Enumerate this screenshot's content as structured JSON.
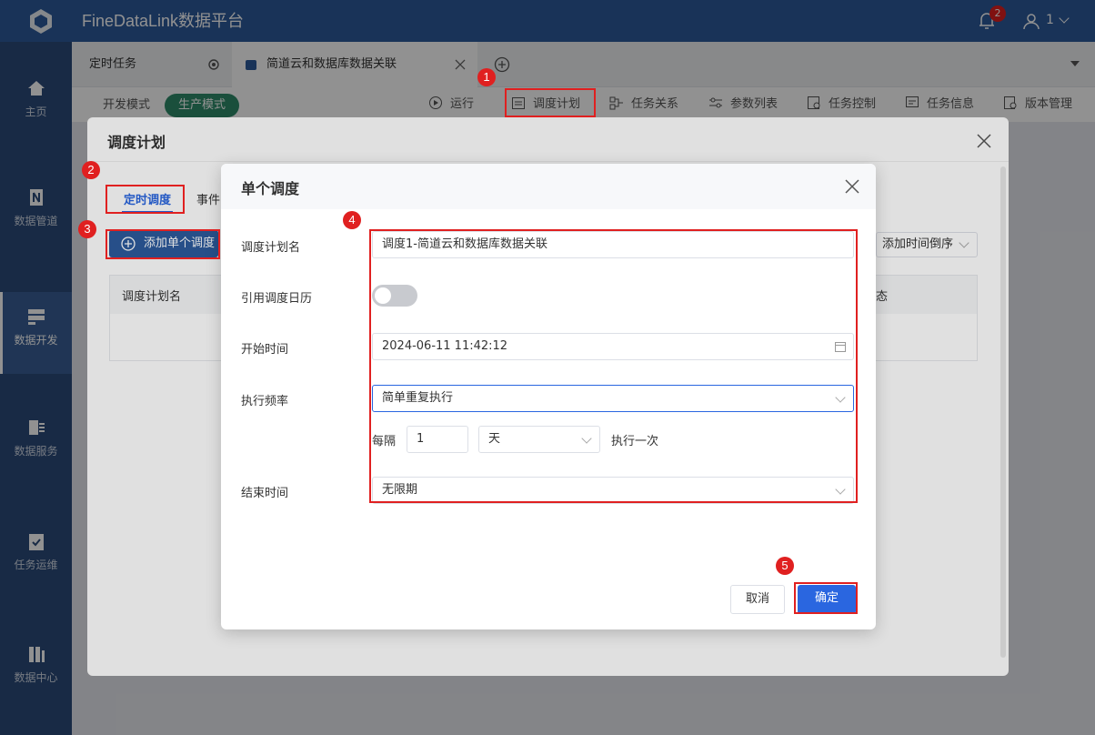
{
  "app": {
    "title": "FineDataLink数据平台",
    "notif_count": "2",
    "user": "1"
  },
  "nav": [
    "主页",
    "数据管道",
    "数据开发",
    "数据服务",
    "任务运维",
    "数据中心"
  ],
  "tabs": {
    "first": "定时任务",
    "second": "简道云和数据库数据关联"
  },
  "mode": {
    "dev": "开发模式",
    "prod": "生产模式"
  },
  "toolbar": {
    "run": "运行",
    "schedule": "调度计划",
    "relation": "任务关系",
    "params": "参数列表",
    "control": "任务控制",
    "info": "任务信息",
    "version": "版本管理"
  },
  "plan": {
    "title": "调度计划",
    "tab_timed": "定时调度",
    "tab_event": "事件",
    "add_btn": "添加单个调度",
    "sort": "添加时间倒序",
    "col_name": "调度计划名",
    "col_status": "态"
  },
  "dialog": {
    "title": "单个调度",
    "name_label": "调度计划名",
    "name_value": "调度1-简道云和数据库数据关联",
    "calendar_label": "引用调度日历",
    "start_label": "开始时间",
    "start_value": "2024-06-11 11:42:12",
    "freq_label": "执行频率",
    "freq_value": "简单重复执行",
    "every": "每隔",
    "interval": "1",
    "unit": "天",
    "exec_once": "执行一次",
    "end_label": "结束时间",
    "end_value": "无限期",
    "cancel": "取消",
    "ok": "确定"
  },
  "steps": [
    "1",
    "2",
    "3",
    "4",
    "5"
  ],
  "colors": {
    "primary": "#2d5b9c",
    "accent": "#2a66e0",
    "highlight": "#e02020"
  }
}
